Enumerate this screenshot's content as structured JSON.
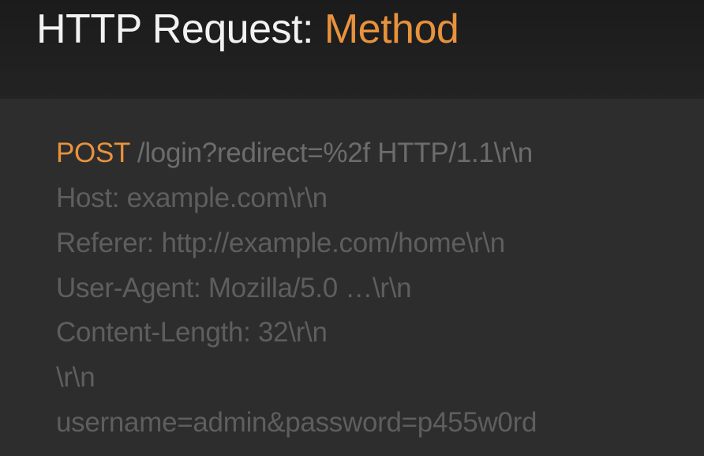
{
  "title": {
    "prefix": "HTTP Request:",
    "highlight": "Method"
  },
  "request": {
    "method": "POST",
    "request_line_rest": " /login?redirect=%2f HTTP/1.1\\r\\n",
    "lines": [
      "Host: example.com\\r\\n",
      "Referer: http://example.com/home\\r\\n",
      "User-Agent: Mozilla/5.0 …\\r\\n",
      "Content-Length: 32\\r\\n",
      "\\r\\n",
      "username=admin&password=p455w0rd"
    ]
  },
  "colors": {
    "accent": "#e8923d",
    "title_text": "#f2f2f2",
    "muted_text": "#5e5e5e",
    "header_bg": "#1e1e1e",
    "body_bg": "#2d2d2d"
  }
}
